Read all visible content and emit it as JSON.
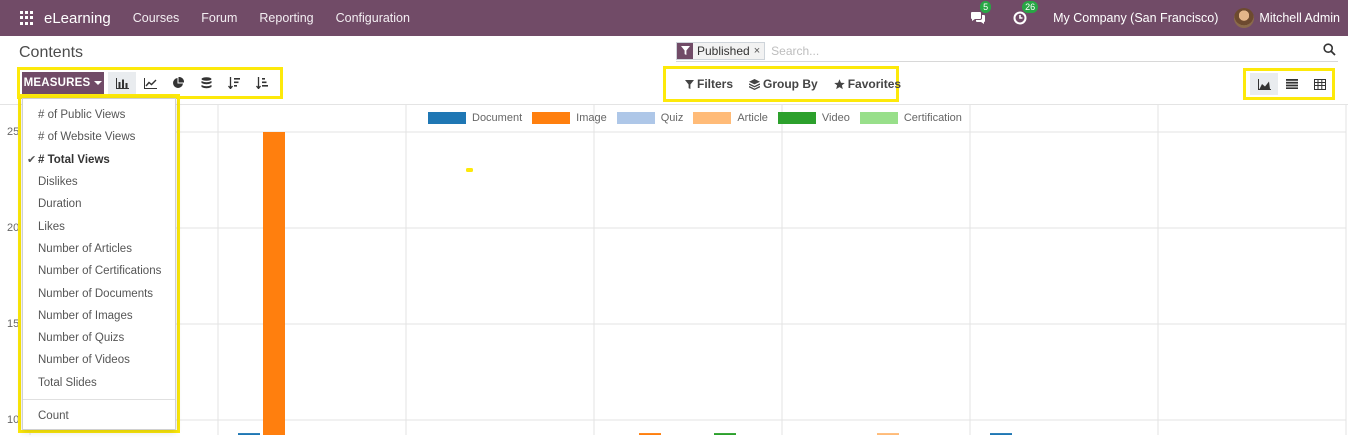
{
  "navbar": {
    "app_name": "eLearning",
    "menu": [
      "Courses",
      "Forum",
      "Reporting",
      "Configuration"
    ],
    "messages_count": "5",
    "activities_count": "26",
    "company": "My Company (San Francisco)",
    "user": "Mitchell Admin"
  },
  "page": {
    "title": "Contents",
    "search": {
      "facet": "Published",
      "remove": "×",
      "placeholder": "Search..."
    }
  },
  "toolbar": {
    "measures_label": "MEASURES",
    "filters_label": "Filters",
    "groupby_label": "Group By",
    "favorites_label": "Favorites"
  },
  "measures_menu": {
    "items": [
      {
        "label": "# of Public Views",
        "selected": false
      },
      {
        "label": "# of Website Views",
        "selected": false
      },
      {
        "label": "# Total Views",
        "selected": true
      },
      {
        "label": "Dislikes",
        "selected": false
      },
      {
        "label": "Duration",
        "selected": false
      },
      {
        "label": "Likes",
        "selected": false
      },
      {
        "label": "Number of Articles",
        "selected": false
      },
      {
        "label": "Number of Certifications",
        "selected": false
      },
      {
        "label": "Number of Documents",
        "selected": false
      },
      {
        "label": "Number of Images",
        "selected": false
      },
      {
        "label": "Number of Quizs",
        "selected": false
      },
      {
        "label": "Number of Videos",
        "selected": false
      },
      {
        "label": "Total Slides",
        "selected": false
      }
    ],
    "count_label": "Count",
    "check_mark": "✔"
  },
  "chart_data": {
    "type": "bar",
    "y_tick_labels": [
      "25",
      "20",
      "15",
      "10"
    ],
    "series": [
      {
        "name": "Document",
        "color": "#1f77b4"
      },
      {
        "name": "Image",
        "color": "#ff7f0e"
      },
      {
        "name": "Quiz",
        "color": "#aec7e8"
      },
      {
        "name": "Article",
        "color": "#ffbb78"
      },
      {
        "name": "Video",
        "color": "#2ca02c"
      },
      {
        "name": "Certification",
        "color": "#98df8a"
      }
    ],
    "bars": [
      {
        "group": 0,
        "series": "Document",
        "value": 10
      },
      {
        "group": 1,
        "series": "Document",
        "value": 10.1
      },
      {
        "group": 1,
        "series": "Image",
        "value": 25.8
      },
      {
        "group": 3,
        "series": "Image",
        "value": 10.1
      },
      {
        "group": 3,
        "series": "Video",
        "value": 10.1
      },
      {
        "group": 4,
        "series": "Article",
        "value": 10.1
      },
      {
        "group": 5,
        "series": "Document",
        "value": 10.1
      }
    ],
    "ylim": [
      10,
      25.8
    ],
    "grid": true,
    "legend_position": "top"
  }
}
